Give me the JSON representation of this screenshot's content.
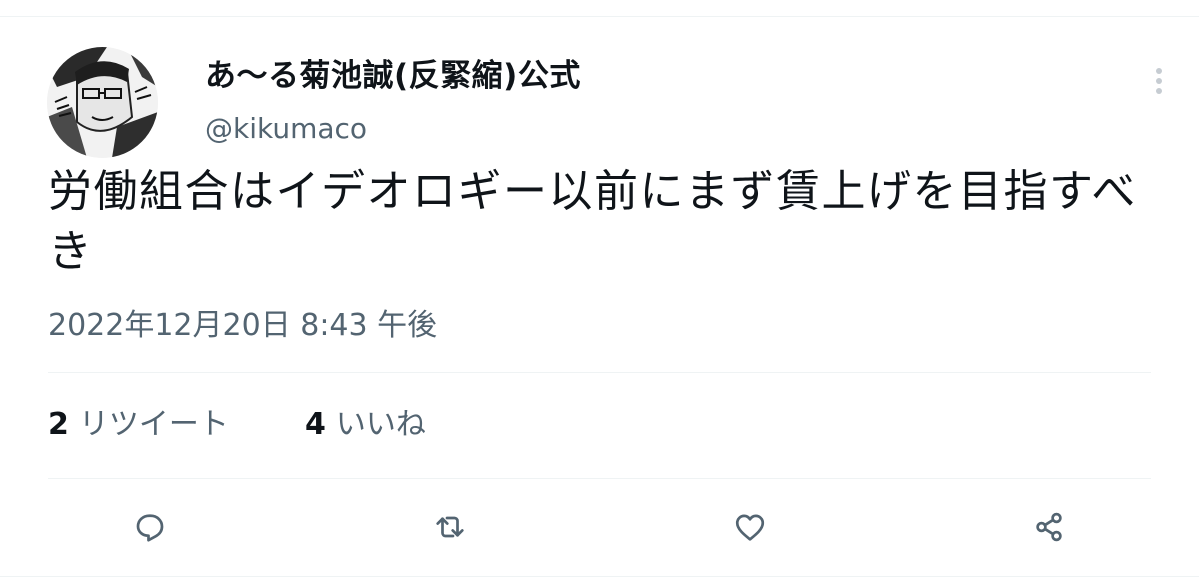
{
  "tweet": {
    "author": {
      "display_name": "あ〜る菊池誠(反緊縮)公式",
      "handle": "@kikumaco"
    },
    "text": "労働組合はイデオロギー以前にまず賃上げを目指すべき",
    "timestamp": "2022年12月20日 8:43 午後"
  },
  "stats": {
    "retweets": {
      "count": "2",
      "label": "リツイート"
    },
    "likes": {
      "count": "4",
      "label": "いいね"
    }
  },
  "actions": [
    {
      "icon": "reply-icon"
    },
    {
      "icon": "retweet-icon"
    },
    {
      "icon": "like-icon"
    },
    {
      "icon": "share-icon"
    }
  ],
  "colors": {
    "text_primary": "#0f1419",
    "text_secondary": "#536471",
    "divider": "#eff3f4"
  }
}
